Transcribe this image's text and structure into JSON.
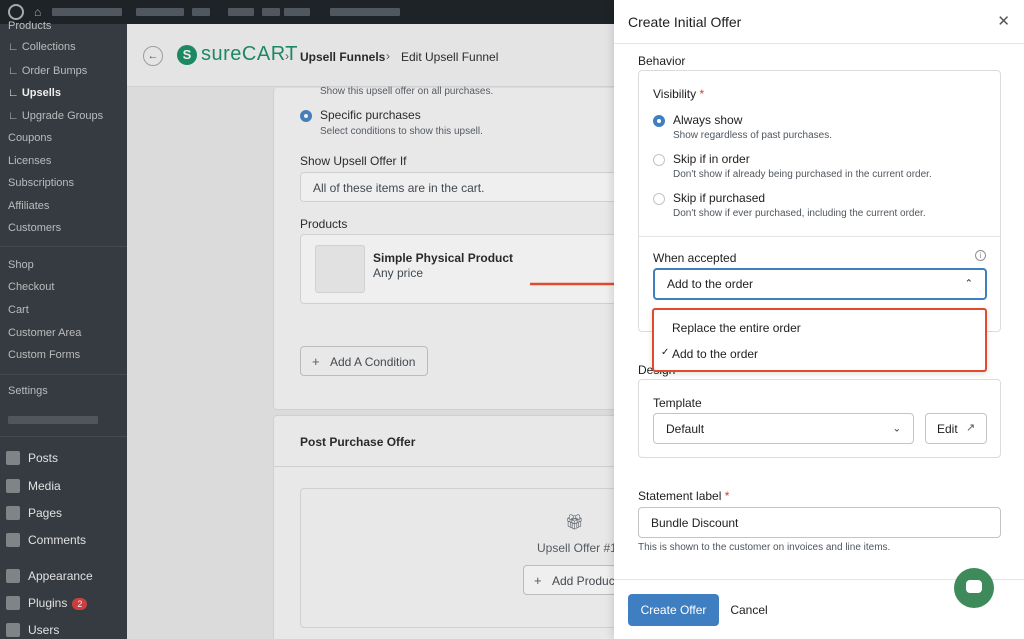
{
  "colors": {
    "accent": "#3f7fc1",
    "brand": "#0f8b5f",
    "highlight": "#e04a2f",
    "required": "#d63638"
  },
  "wp_menu": {
    "items": [
      {
        "label": "Products",
        "y": 0
      },
      {
        "label": "∟ Collections"
      },
      {
        "label": "∟ Order Bumps"
      },
      {
        "label": "∟ Upsells"
      },
      {
        "label": "∟ Upgrade Groups"
      },
      {
        "label": "Coupons"
      },
      {
        "label": "Licenses"
      },
      {
        "label": "Subscriptions"
      },
      {
        "label": "Affiliates"
      },
      {
        "label": "Customers"
      },
      {
        "label": "Shop"
      },
      {
        "label": "Checkout"
      },
      {
        "label": "Cart"
      },
      {
        "label": "Customer Area"
      },
      {
        "label": "Custom Forms"
      },
      {
        "label": "Settings"
      },
      {
        "label": "Posts"
      },
      {
        "label": "Media"
      },
      {
        "label": "Pages"
      },
      {
        "label": "Comments"
      },
      {
        "label": "Appearance"
      },
      {
        "label": "Plugins"
      },
      {
        "label": "Users"
      }
    ],
    "plugins_badge": "2"
  },
  "breadcrumb": {
    "brand": "sureCART",
    "funnels": "Upsell Funnels",
    "current": "Edit Upsell Funnel"
  },
  "background": {
    "all_purchases_desc": "Show this upsell offer on all purchases.",
    "specific_label": "Specific purchases",
    "specific_desc": "Select conditions to show this upsell.",
    "show_if_label": "Show Upsell Offer If",
    "show_if_value": "All of these items are in the cart.",
    "products_label": "Products",
    "product_name": "Simple Physical Product",
    "product_price": "Any price",
    "add_condition": "Add A Condition",
    "post_purchase_title": "Post Purchase Offer",
    "upsell_offer_label": "Upsell Offer #1",
    "add_product": "Add Product"
  },
  "drawer": {
    "title": "Create Initial Offer",
    "behavior_label": "Behavior",
    "visibility_label": "Visibility",
    "visibility_options": [
      {
        "title": "Always show",
        "desc": "Show regardless of past purchases."
      },
      {
        "title": "Skip if in order",
        "desc": "Don't show if already being purchased in the current order."
      },
      {
        "title": "Skip if purchased",
        "desc": "Don't show if ever purchased, including the current order."
      }
    ],
    "when_accepted_label": "When accepted",
    "when_accepted_value": "Add to the order",
    "when_accepted_options": [
      {
        "label": "Replace the entire order",
        "checked": false
      },
      {
        "label": "Add to the order",
        "checked": true
      }
    ],
    "design_label": "Design",
    "template_label": "Template",
    "template_value": "Default",
    "edit_label": "Edit",
    "statement_label": "Statement label",
    "statement_value": "Bundle Discount",
    "statement_help": "This is shown to the customer on invoices and line items.",
    "create_button": "Create Offer",
    "cancel_button": "Cancel"
  }
}
